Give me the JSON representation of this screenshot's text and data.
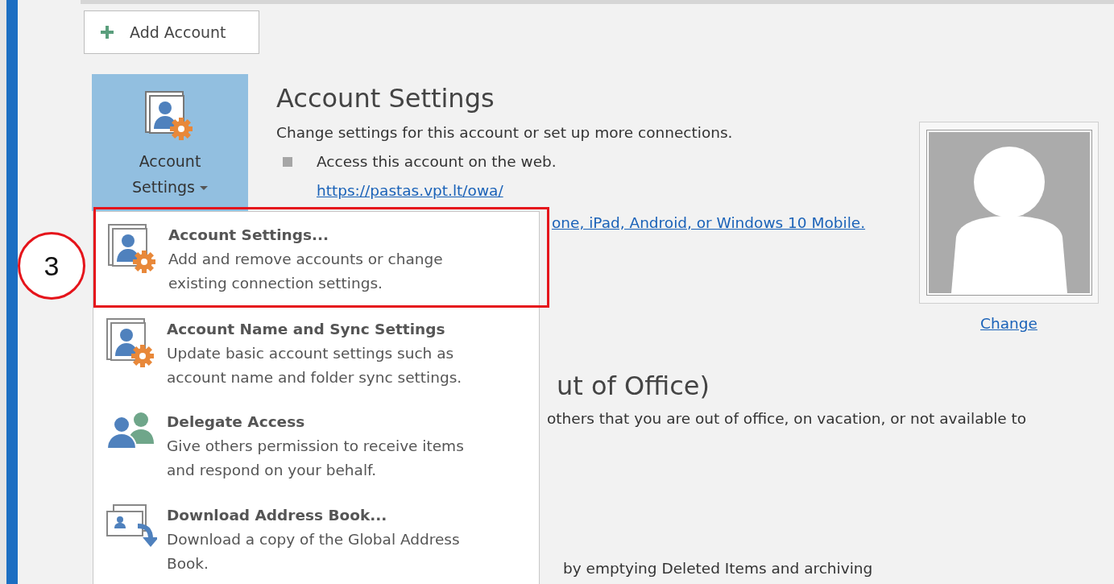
{
  "add_account_button": {
    "label": "Add Account"
  },
  "account_settings_tile": {
    "label": "Account Settings",
    "expanded": true
  },
  "account_settings_section": {
    "title": "Account Settings",
    "description": "Change settings for this account or set up more connections.",
    "bullets": [
      "Access this account on the web."
    ],
    "link": "https://pastas.vpt.lt/owa/",
    "partial_link": "one, iPad, Android, or Windows 10 Mobile."
  },
  "profile_photo": {
    "change_link": "Change"
  },
  "out_of_office_section": {
    "title": "ut of Office)",
    "description": "others that you are out of office, on vacation, or not available to",
    "footer_text": "by emptying Deleted Items and archiving"
  },
  "dropdown_menu": [
    {
      "kind": "account",
      "title": "Account Settings...",
      "description": "Add and remove accounts or change existing connection settings.",
      "highlighted": true
    },
    {
      "kind": "account",
      "title": "Account Name and Sync Settings",
      "description": "Update basic account settings such as account name and folder sync settings.",
      "highlighted": false
    },
    {
      "kind": "delegate",
      "title": "Delegate Access",
      "description": "Give others permission to receive items and respond on your behalf.",
      "highlighted": false
    },
    {
      "kind": "addressbook",
      "title": "Download Address Book...",
      "description": "Download a copy of the Global Address Book.",
      "highlighted": false
    }
  ],
  "step_marker": {
    "label": "3"
  }
}
